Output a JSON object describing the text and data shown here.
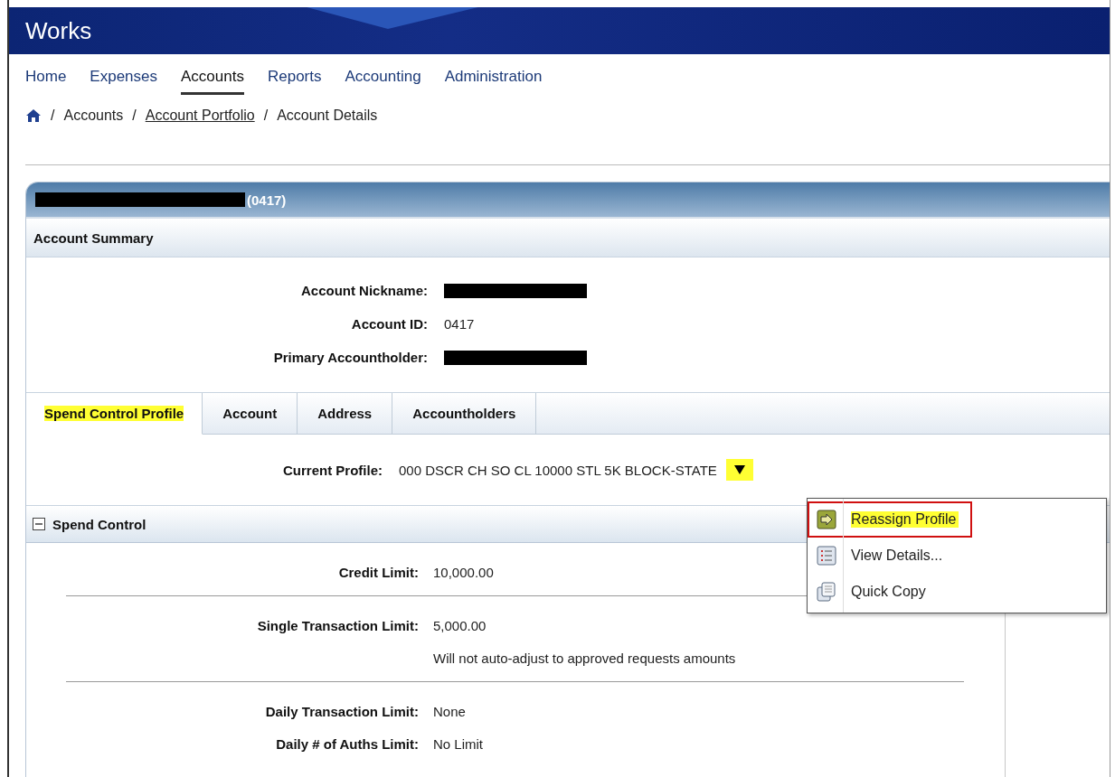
{
  "header": {
    "logo": "Works"
  },
  "nav": [
    {
      "label": "Home",
      "selected": false
    },
    {
      "label": "Expenses",
      "selected": false
    },
    {
      "label": "Accounts",
      "selected": true
    },
    {
      "label": "Reports",
      "selected": false
    },
    {
      "label": "Accounting",
      "selected": false
    },
    {
      "label": "Administration",
      "selected": false
    }
  ],
  "breadcrumb": [
    {
      "separator": "/",
      "label": "Accounts",
      "link": false
    },
    {
      "separator": "/",
      "label": "Account Portfolio",
      "link": true
    },
    {
      "separator": "/",
      "label": "Account Details",
      "link": false
    }
  ],
  "panel": {
    "title_redacted": true,
    "title_suffix": "(0417)",
    "section": "Account Summary",
    "fields": [
      {
        "label": "Account Nickname:",
        "redacted": true
      },
      {
        "label": "Account ID:",
        "redacted": false,
        "value": "0417"
      },
      {
        "label": "Primary Accountholder:",
        "redacted": true
      }
    ]
  },
  "tabs": [
    {
      "label": "Spend Control Profile",
      "selected": true,
      "highlighted": true
    },
    {
      "label": "Account",
      "selected": false,
      "highlighted": false
    },
    {
      "label": "Address",
      "selected": false,
      "highlighted": false
    },
    {
      "label": "Accountholders",
      "selected": false,
      "highlighted": false
    }
  ],
  "current_profile": {
    "label": "Current Profile:",
    "value": "000 DSCR CH SO CL 10000 STL 5K BLOCK-STATE",
    "highlighted": true
  },
  "menu": [
    {
      "kind": "reassign",
      "label": "Reassign Profile",
      "highlighted": true,
      "outlined": true
    },
    {
      "kind": "details",
      "label": "View Details...",
      "highlighted": false,
      "outlined": false
    },
    {
      "kind": "copy",
      "label": "Quick Copy",
      "highlighted": false,
      "outlined": false
    }
  ],
  "spend_control": {
    "title": "Spend Control",
    "expanded": true,
    "groups": [
      {
        "rows": [
          {
            "label": "Credit Limit:",
            "value": "10,000.00"
          }
        ]
      },
      {
        "rows": [
          {
            "label": "Single Transaction Limit:",
            "value": "5,000.00"
          },
          {
            "value": "Will not auto-adjust to approved requests amounts"
          }
        ]
      },
      {
        "rows": [
          {
            "label": "Daily Transaction Limit:",
            "value": "None"
          },
          {
            "label": "Daily # of Auths Limit:",
            "value": "No Limit"
          }
        ]
      }
    ]
  }
}
